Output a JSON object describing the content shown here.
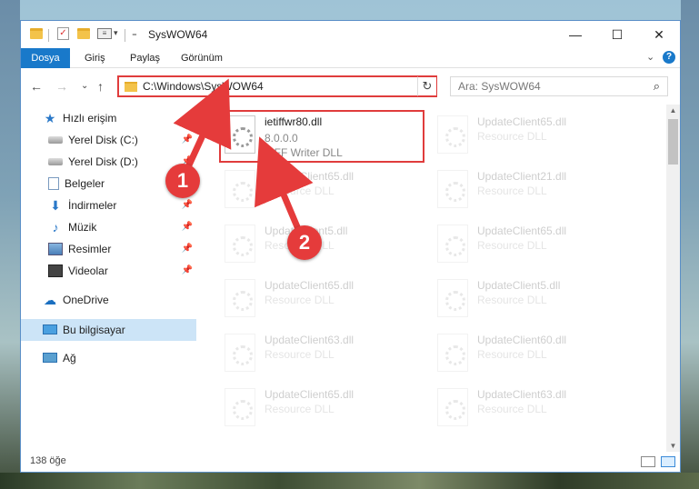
{
  "window": {
    "title": "SysWOW64",
    "controls": {
      "minimize": "—",
      "maximize": "☐",
      "close": "✕"
    }
  },
  "ribbon": {
    "tabs": [
      "Dosya",
      "Giriş",
      "Paylaş",
      "Görünüm"
    ],
    "collapse": "⌄",
    "help": "?"
  },
  "nav": {
    "back": "←",
    "forward": "→",
    "recent": "⌄",
    "up": "↑",
    "address": "C:\\Windows\\SysWOW64",
    "address_drop": "⌄",
    "refresh": "↻",
    "search_placeholder": "Ara: SysWOW64",
    "search_icon": "⌕"
  },
  "sidebar": {
    "items": [
      {
        "label": "Hızlı erişim",
        "icon": "star-icon",
        "pinned": false
      },
      {
        "label": "Yerel Disk (C:)",
        "icon": "disk-icon",
        "pinned": true
      },
      {
        "label": "Yerel Disk (D:)",
        "icon": "disk-icon",
        "pinned": true
      },
      {
        "label": "Belgeler",
        "icon": "document-icon",
        "pinned": true
      },
      {
        "label": "İndirmeler",
        "icon": "download-icon",
        "pinned": true
      },
      {
        "label": "Müzik",
        "icon": "music-icon",
        "pinned": true
      },
      {
        "label": "Resimler",
        "icon": "pictures-icon",
        "pinned": true
      },
      {
        "label": "Videolar",
        "icon": "videos-icon",
        "pinned": true
      },
      {
        "label": "OneDrive",
        "icon": "cloud-icon",
        "pinned": false
      },
      {
        "label": "Bu bilgisayar",
        "icon": "pc-icon",
        "pinned": false,
        "selected": true
      },
      {
        "label": "Ağ",
        "icon": "network-icon",
        "pinned": false
      }
    ]
  },
  "files": {
    "highlighted": {
      "name": "ietiffwr80.dll",
      "version": "8.0.0.0",
      "description": "TIFF Writer DLL"
    },
    "background": [
      {
        "name": "UpdateClient65.dll",
        "desc": "Resource DLL"
      },
      {
        "name": "UpdateClient65.dll",
        "desc": "Resource DLL"
      },
      {
        "name": "UpdateClient21.dll",
        "desc": "Resource DLL"
      },
      {
        "name": "UpdateClient5.dll",
        "desc": "Resource DLL"
      },
      {
        "name": "UpdateClient65.dll",
        "desc": "Resource DLL"
      },
      {
        "name": "UpdateClient65.dll",
        "desc": "Resource DLL"
      },
      {
        "name": "UpdateClient5.dll",
        "desc": "Resource DLL"
      },
      {
        "name": "UpdateClient63.dll",
        "desc": "Resource DLL"
      },
      {
        "name": "UpdateClient60.dll",
        "desc": "Resource DLL"
      },
      {
        "name": "UpdateClient65.dll",
        "desc": "Resource DLL"
      },
      {
        "name": "UpdateClient63.dll",
        "desc": "Resource DLL"
      }
    ]
  },
  "status": {
    "count": "138 öğe"
  },
  "annotations": {
    "step1": "1",
    "step2": "2"
  },
  "colors": {
    "accent": "#1979ca",
    "annotation": "#e03c3c"
  }
}
